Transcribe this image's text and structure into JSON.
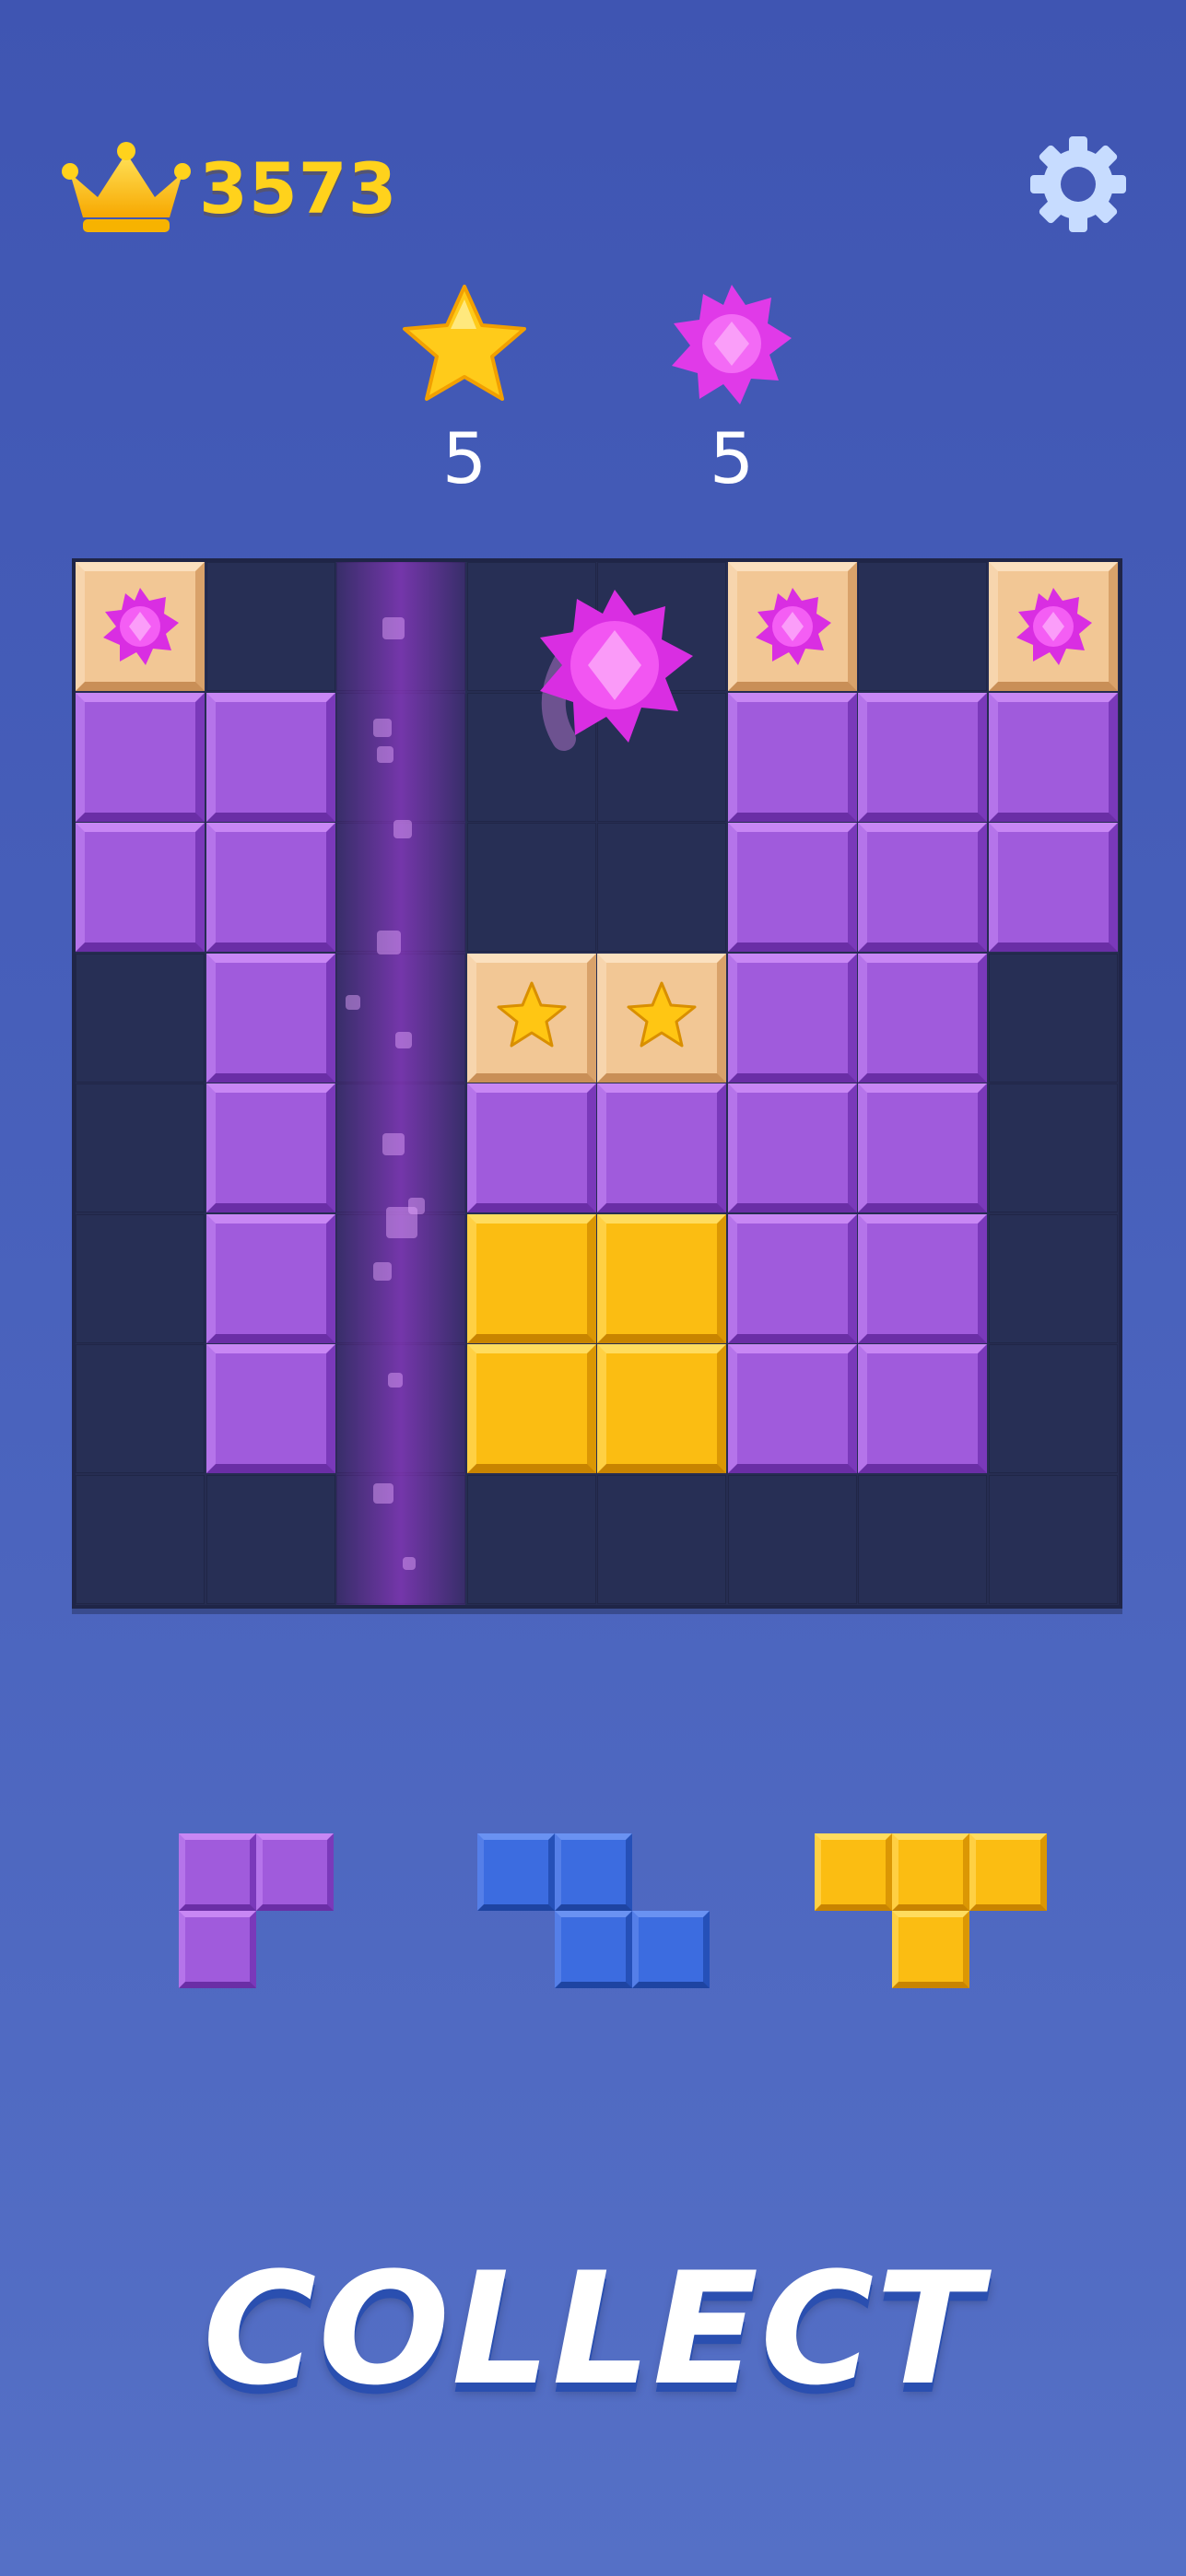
{
  "header": {
    "score": "3573",
    "score_icon": "crown-icon",
    "settings_icon": "gear-icon"
  },
  "goals": [
    {
      "icon": "star-icon",
      "count": "5",
      "color": "#ffcc1a"
    },
    {
      "icon": "pink-gem-icon",
      "count": "5",
      "color": "#e03ae8"
    }
  ],
  "board": {
    "rows": 8,
    "cols": 8,
    "grid": [
      [
        "WG",
        "",
        "",
        "",
        "",
        "WG",
        "",
        "WG"
      ],
      [
        "P",
        "P",
        "",
        "",
        "",
        "P",
        "P",
        "P"
      ],
      [
        "P",
        "P",
        "",
        "",
        "",
        "P",
        "P",
        "P"
      ],
      [
        "",
        "P",
        "",
        "WS",
        "WS",
        "P",
        "P",
        ""
      ],
      [
        "",
        "P",
        "",
        "P",
        "P",
        "P",
        "P",
        ""
      ],
      [
        "",
        "P",
        "",
        "Y",
        "Y",
        "P",
        "P",
        ""
      ],
      [
        "",
        "P",
        "",
        "Y",
        "Y",
        "P",
        "P",
        ""
      ],
      [
        "",
        "",
        "",
        "",
        "",
        "",
        "",
        ""
      ]
    ],
    "legend": {
      "P": "purple-block",
      "Y": "yellow-block",
      "WS": "wooden-star-block",
      "WG": "wooden-gem-block"
    },
    "cleared_column": 2,
    "flying_item": "pink-gem-icon"
  },
  "tray": {
    "pieces": [
      {
        "color": "purple",
        "cells": [
          [
            0,
            0
          ],
          [
            0,
            1
          ],
          [
            1,
            0
          ]
        ]
      },
      {
        "color": "blue",
        "cells": [
          [
            0,
            0
          ],
          [
            0,
            1
          ],
          [
            1,
            1
          ],
          [
            1,
            2
          ]
        ]
      },
      {
        "color": "yellow",
        "cells": [
          [
            0,
            0
          ],
          [
            0,
            1
          ],
          [
            0,
            2
          ],
          [
            1,
            1
          ]
        ]
      }
    ]
  },
  "banner": {
    "text": "COLLECT"
  },
  "colors": {
    "background": "#4760bb",
    "board_bg": "#272f55",
    "purple": "#a05bdc",
    "yellow": "#fbbd12",
    "blue": "#3c6ce0",
    "wood": "#f2c795",
    "score": "#ffd21c"
  }
}
